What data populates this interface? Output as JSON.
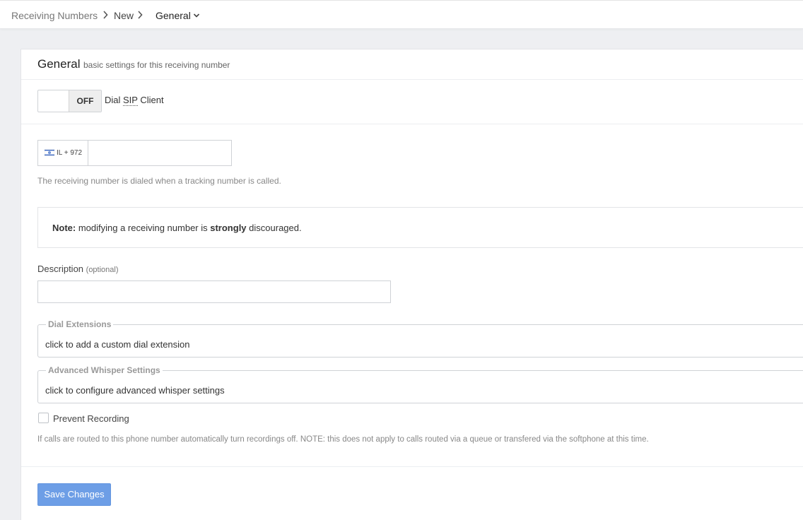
{
  "breadcrumb": {
    "items": [
      "Receiving Numbers",
      "New",
      "General"
    ]
  },
  "section": {
    "title": "General",
    "subtitle": "basic settings for this receiving number"
  },
  "sip_toggle": {
    "state_label": "OFF",
    "label_prefix": "Dial ",
    "label_abbr": "SIP",
    "label_suffix": " Client"
  },
  "phone": {
    "country_prefix": "IL + 972",
    "value": "",
    "help": "The receiving number is dialed when a tracking number is called."
  },
  "note": {
    "bold_label": "Note:",
    "text_before": " modifying a receiving number is ",
    "emphasis": "strongly",
    "text_after": " discouraged."
  },
  "description": {
    "label": "Description",
    "optional": "(optional)",
    "value": ""
  },
  "dial_extensions": {
    "legend": "Dial Extensions",
    "text": "click to add a custom dial extension"
  },
  "whisper": {
    "legend": "Advanced Whisper Settings",
    "text": "click to configure advanced whisper settings"
  },
  "prevent_recording": {
    "label": "Prevent Recording",
    "checked": false,
    "help": "If calls are routed to this phone number automatically turn recordings off. NOTE: this does not apply to calls routed via a queue or transfered via the softphone at this time."
  },
  "actions": {
    "save_label": "Save Changes"
  },
  "colors": {
    "primary_button": "#6d9ee6",
    "page_background": "#eeeff2",
    "flag_blue": "#2f5fbf"
  },
  "icons": {
    "breadcrumb_separator": "chevron-right-icon",
    "breadcrumb_dropdown": "chevron-down-icon",
    "country_flag": "israel-flag-icon"
  }
}
